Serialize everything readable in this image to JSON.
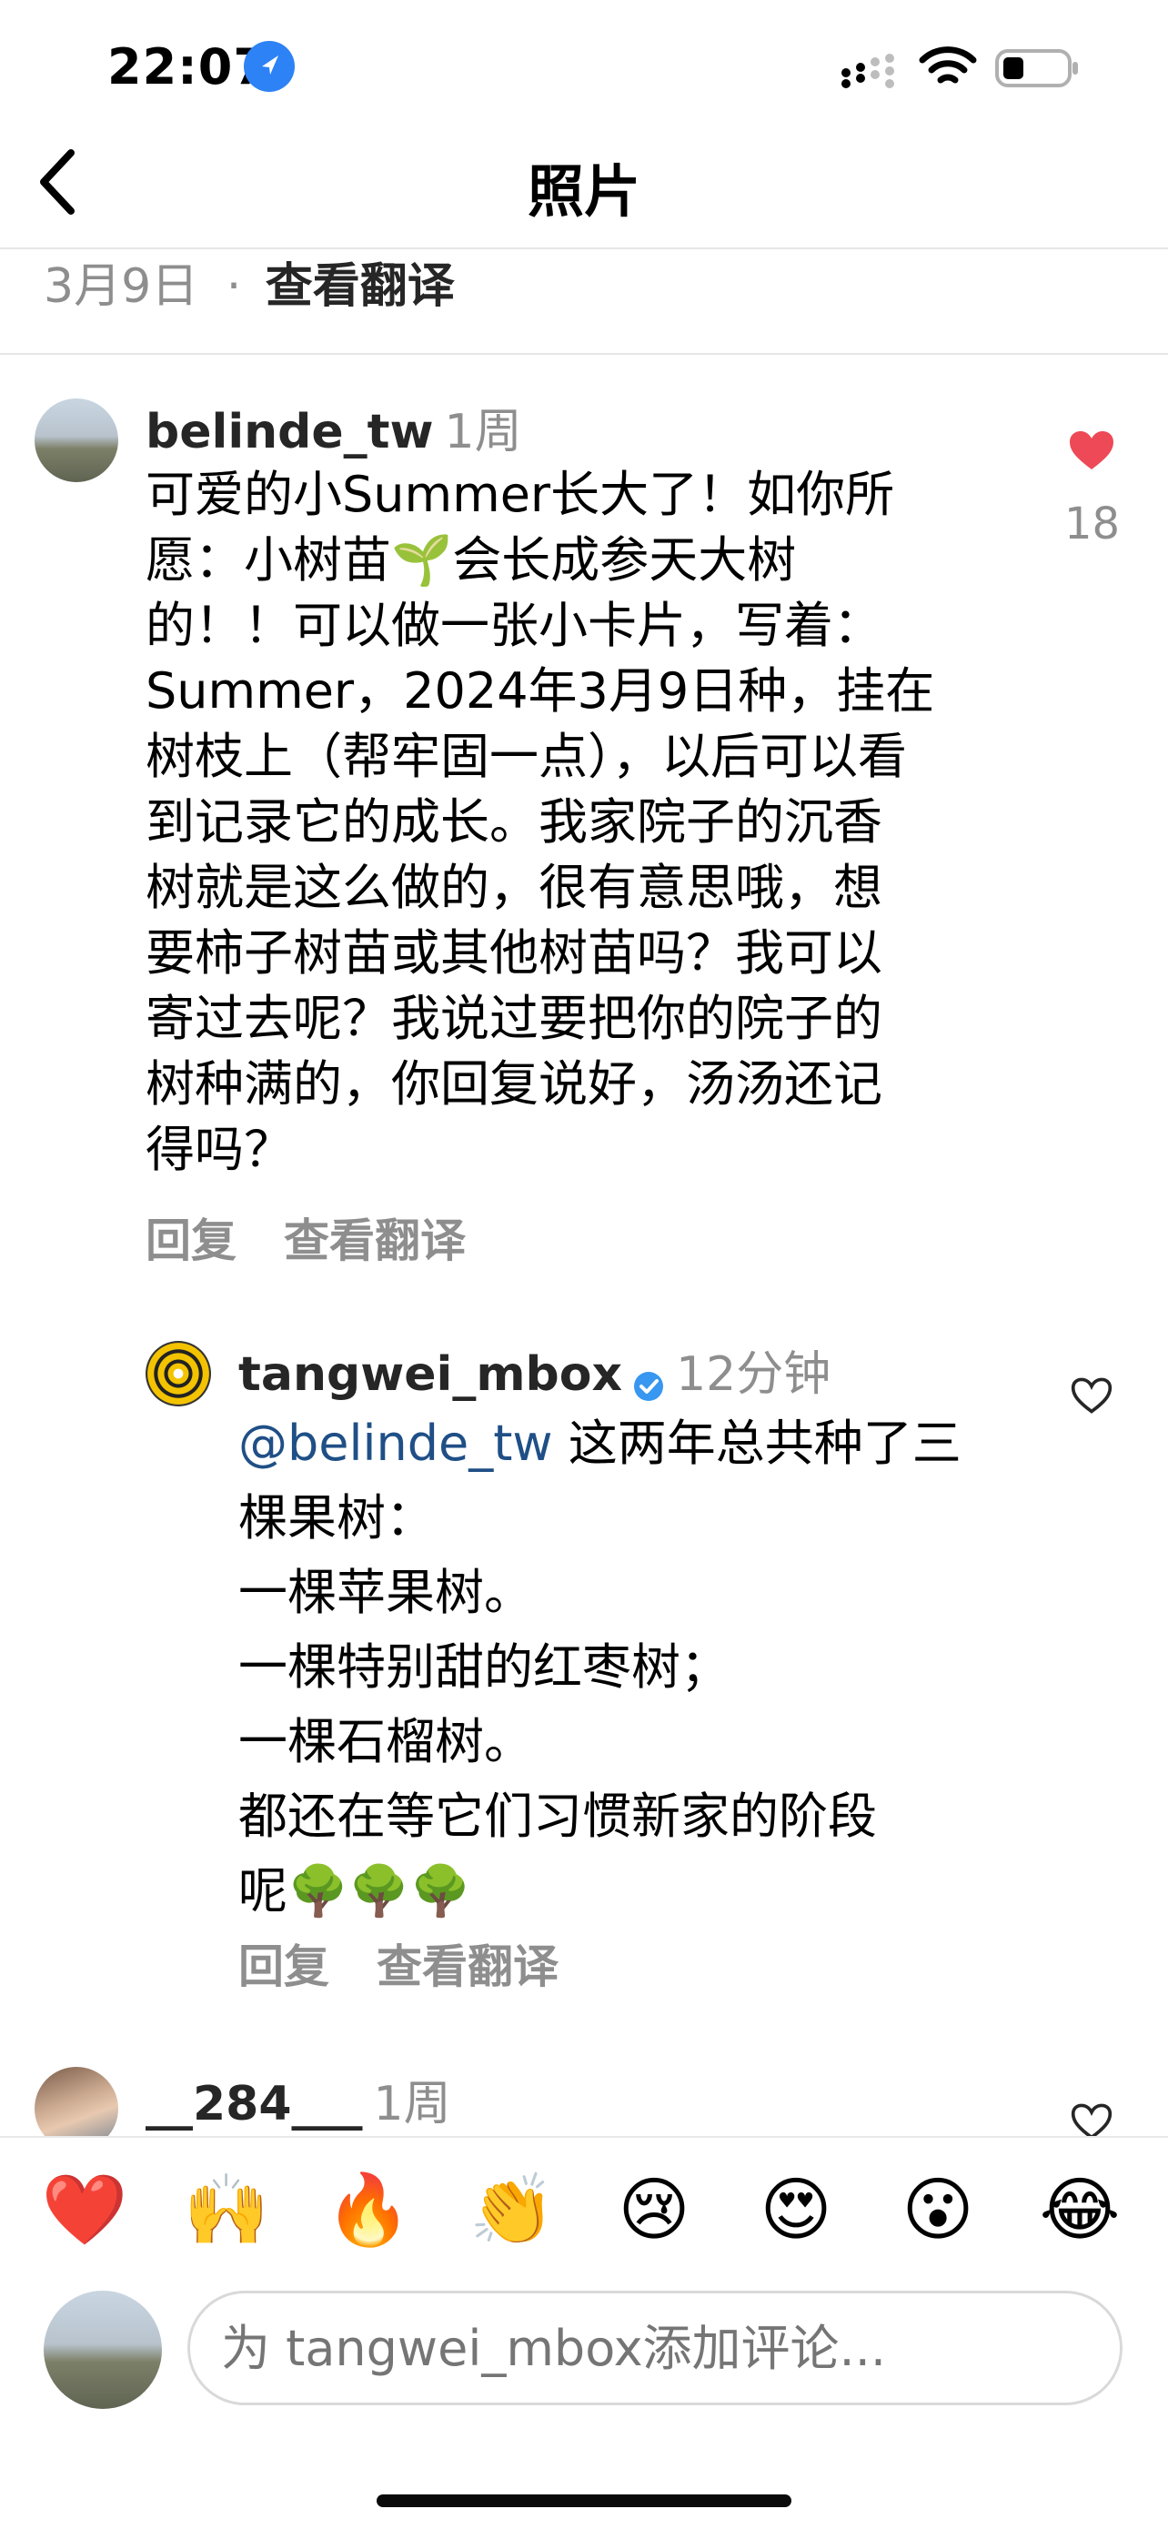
{
  "status_bar": {
    "time": "22:07"
  },
  "nav": {
    "title": "照片"
  },
  "post": {
    "date": "3月9日",
    "separator": "·",
    "translate": "查看翻译"
  },
  "comments": [
    {
      "username": "belinde_tw",
      "age": "1周",
      "text_lines": [
        "可爱的小Summer长大了！如你所",
        "愿：小树苗🌱会长成参天大树",
        "的！！可以做一张小卡片，写着：",
        "Summer，2024年3月9日种，挂在",
        "树枝上（帮牢固一点），以后可以看",
        "到记录它的成长。我家院子的沉香",
        "树就是这么做的，很有意思哦，想",
        "要柿子树苗或其他树苗吗？我可以",
        "寄过去呢？我说过要把你的院子的",
        "树种满的，你回复说好，汤汤还记",
        "得吗？"
      ],
      "like_count": "18",
      "reply": "回复",
      "translate": "查看翻译"
    },
    {
      "username": "tangwei_mbox",
      "age": "12分钟",
      "mention": "@belinde_tw",
      "text_lines": [
        " 这两年总共种了三",
        "棵果树：",
        "一棵苹果树。",
        "一棵特别甜的红枣树；",
        "一棵石榴树。",
        "都还在等它们习惯新家的阶段",
        "呢🌳🌳🌳"
      ],
      "reply": "回复",
      "translate": "查看翻译"
    },
    {
      "username": "__284___",
      "age": "1周"
    }
  ],
  "emoji_bar": [
    "❤️",
    "🙌",
    "🔥",
    "👏",
    "😢",
    "😍",
    "😮",
    "😂"
  ],
  "input": {
    "placeholder": "为 tangwei_mbox添加评论..."
  },
  "colors": {
    "accent_like": "#ed4956",
    "verified": "#3897f0",
    "mention": "#1f4f86",
    "secondary_text": "#8e8e8e"
  }
}
